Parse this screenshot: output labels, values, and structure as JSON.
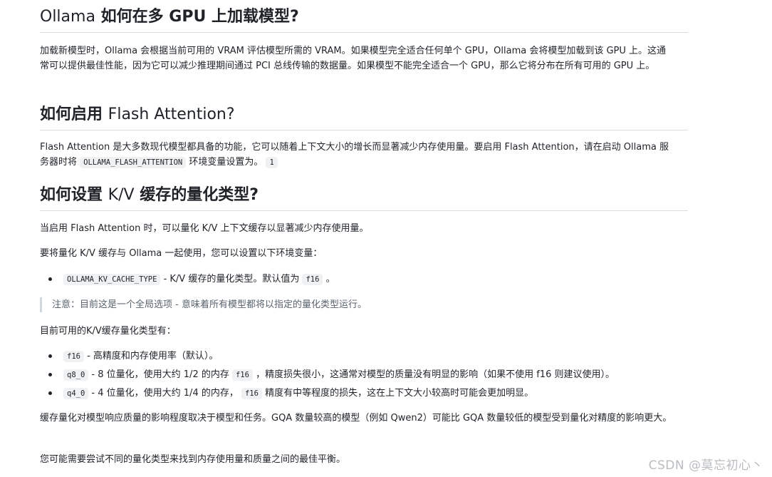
{
  "sections": [
    {
      "heading_latin": "Ollama",
      "heading_rest": " 如何在多 GPU 上加载模型?",
      "paragraph": "加载新模型时，Ollama 会根据当前可用的 VRAM 评估模型所需的 VRAM。如果模型完全适合任何单个 GPU，Ollama 会将模型加载到该 GPU 上。这通常可以提供最佳性能，因为它可以减少推理期间通过 PCI 总线传输的数据量。如果模型不能完全适合一个 GPU，那么它将分布在所有可用的 GPU 上。"
    },
    {
      "heading_cn": "如何启用 ",
      "heading_latin": "Flash Attention?",
      "paragraph_pre": "Flash Attention 是大多数现代模型都具备的功能，它可以随着上下文大小的增长而显著减少内存使用量。要启用 Flash Attention，请在启动 Ollama 服务器时将 ",
      "code1": "OLLAMA_FLASH_ATTENTION",
      "paragraph_mid": " 环境变量设置为。 ",
      "code2": "1"
    },
    {
      "heading_cn1": "如何设置 ",
      "heading_latin": "K/V",
      "heading_cn2": " 缓存的量化类型?",
      "p1": "当启用 Flash Attention 时，可以量化 K/V 上下文缓存以显著减少内存使用量。",
      "p2": "要将量化 K/V 缓存与 Ollama 一起使用，您可以设置以下环境变量：",
      "env_item": {
        "code": "OLLAMA_KV_CACHE_TYPE",
        "text": " - K/V 缓存的量化类型。默认值为 ",
        "code2": "f16",
        "tail": " 。"
      },
      "note": "注意：目前这是一个全局选项 - 意味着所有模型都将以指定的量化类型运行。",
      "p3": "目前可用的K/V缓存量化类型有：",
      "types": [
        {
          "code": "f16",
          "text": " - 高精度和内存使用率（默认）。",
          "code2": "",
          "tail": ""
        },
        {
          "code": "q8_0",
          "text": " - 8 位量化，使用大约 1/2 的内存 ",
          "code2": "f16",
          "tail": " ，精度损失很小，这通常对模型的质量没有明显的影响（如果不使用 f16 则建议使用）。"
        },
        {
          "code": "q4_0",
          "text": " - 4 位量化，使用大约 1/4 的内存， ",
          "code2": "f16",
          "tail": " 精度有中等程度的损失，这在上下文大小较高时可能会更加明显。"
        }
      ],
      "p4": "缓存量化对模型响应质量的影响程度取决于模型和任务。GQA 数量较高的模型（例如 Qwen2）可能比 GQA 数量较低的模型受到量化对精度的影响更大。",
      "p5": "您可能需要尝试不同的量化类型来找到内存使用量和质量之间的最佳平衡。"
    }
  ],
  "watermark": "CSDN @莫忘初心丶"
}
